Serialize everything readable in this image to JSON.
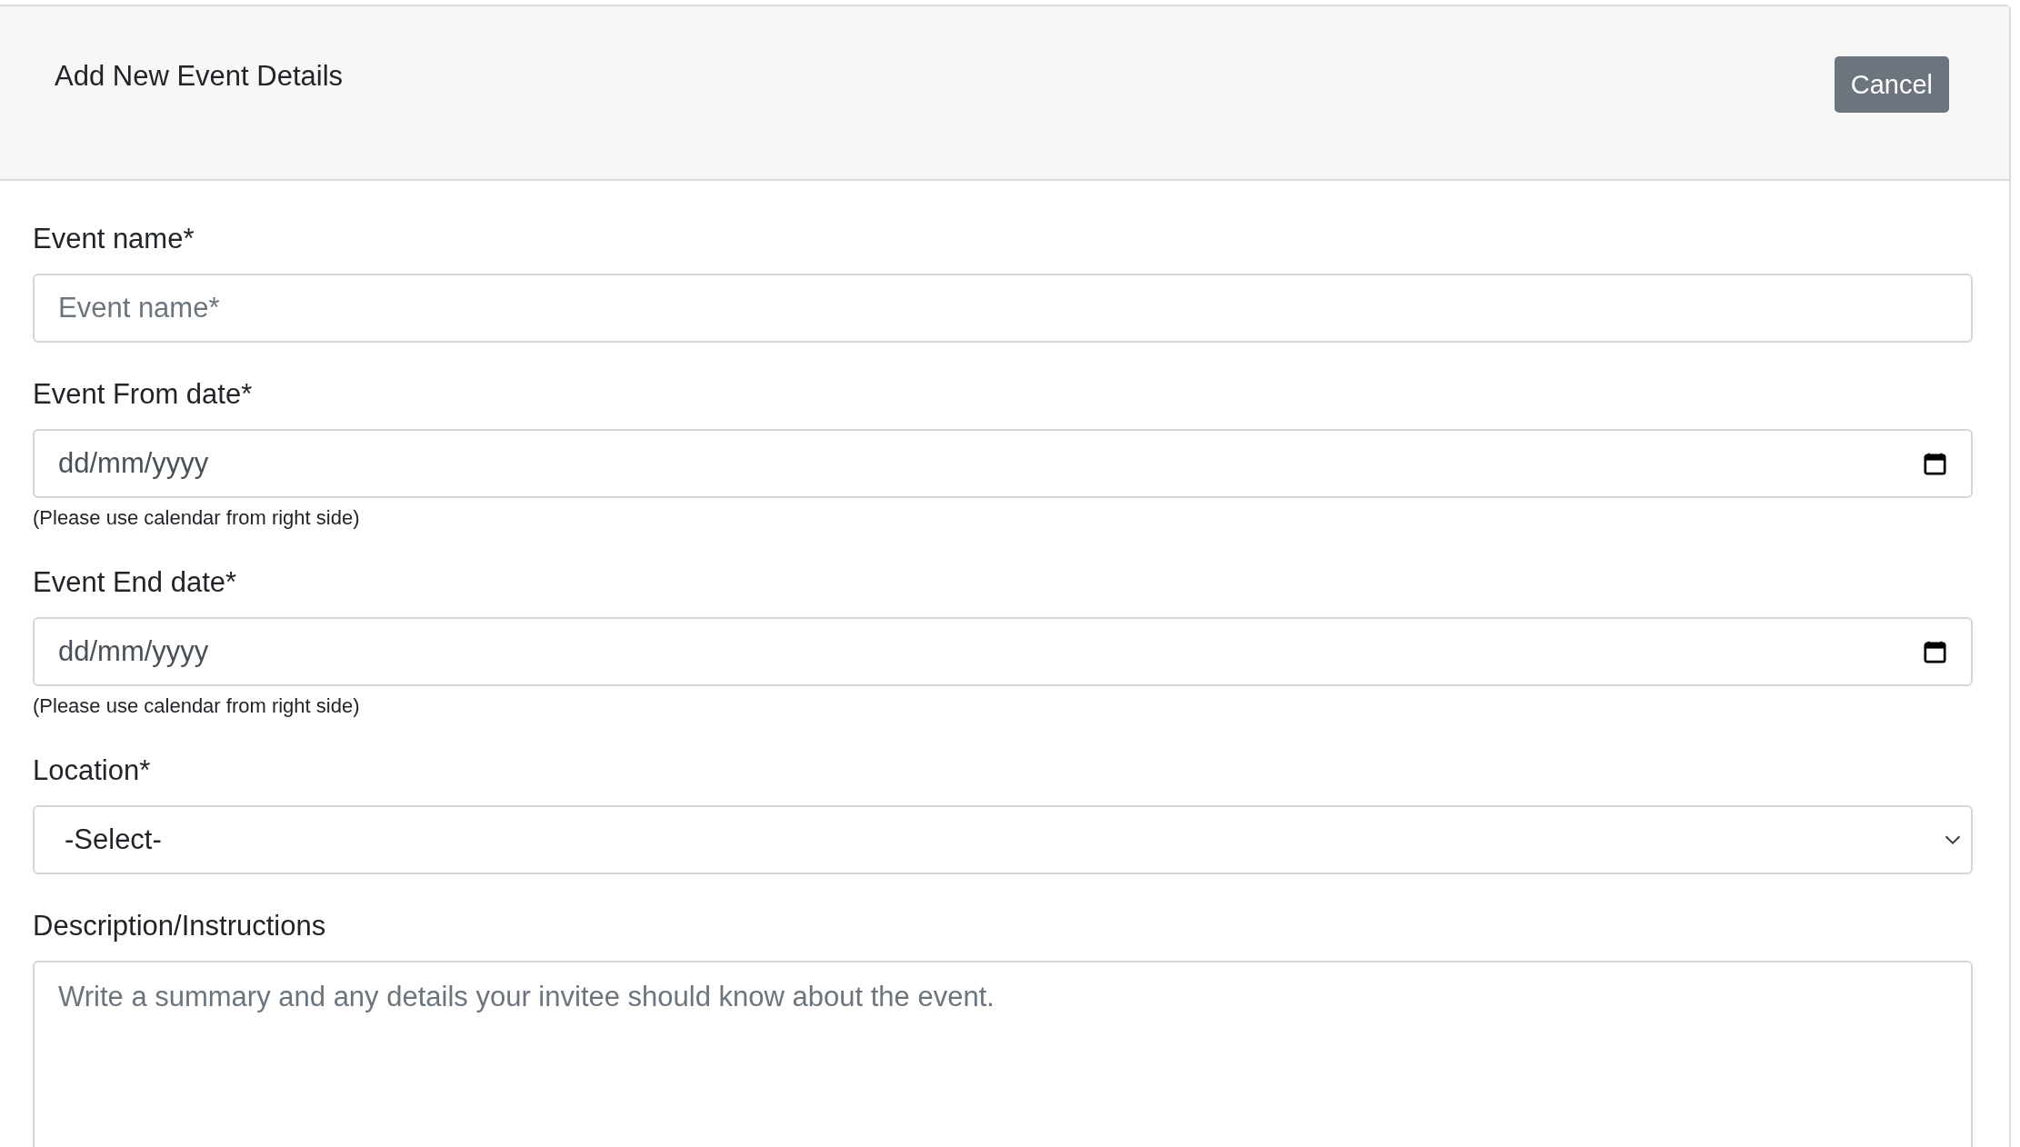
{
  "header": {
    "title": "Add New Event Details",
    "cancel_button": "Cancel"
  },
  "fields": [
    {
      "kind": "text",
      "label": "Event name*",
      "placeholder": "Event name*"
    },
    {
      "kind": "date",
      "label": "Event From date*",
      "value": "dd/mm/yyyy",
      "help": "(Please use calendar from right side)"
    },
    {
      "kind": "date",
      "label": "Event End date*",
      "value": "dd/mm/yyyy",
      "help": "(Please use calendar from right side)"
    },
    {
      "kind": "select",
      "label": "Location*",
      "value": "-Select-"
    },
    {
      "kind": "textarea",
      "label": "Description/Instructions",
      "placeholder": "Write a summary and any details your invitee should know about the event."
    }
  ]
}
